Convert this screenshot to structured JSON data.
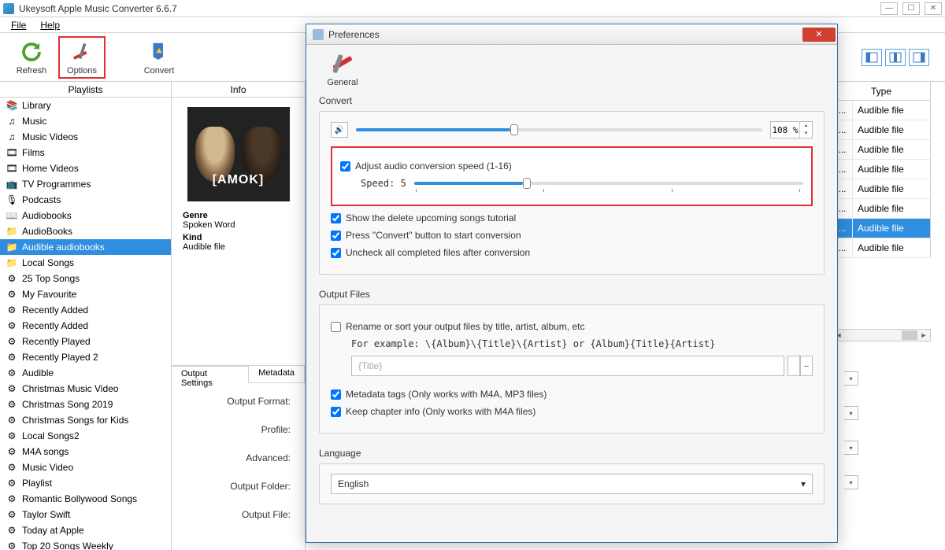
{
  "window": {
    "title": "Ukeysoft Apple Music Converter 6.6.7"
  },
  "menu": {
    "file": "File",
    "help": "Help"
  },
  "toolbar": {
    "refresh": "Refresh",
    "options": "Options",
    "convert": "Convert"
  },
  "sidebar": {
    "header": "Playlists",
    "items": [
      {
        "label": "Library",
        "icon": "library"
      },
      {
        "label": "Music",
        "icon": "music"
      },
      {
        "label": "Music Videos",
        "icon": "music"
      },
      {
        "label": "Films",
        "icon": "film"
      },
      {
        "label": "Home Videos",
        "icon": "film"
      },
      {
        "label": "TV Programmes",
        "icon": "tv"
      },
      {
        "label": "Podcasts",
        "icon": "podcast"
      },
      {
        "label": "Audiobooks",
        "icon": "book"
      },
      {
        "label": "AudioBooks",
        "icon": "folder"
      },
      {
        "label": "Audible audiobooks",
        "icon": "folder",
        "selected": true
      },
      {
        "label": "Local Songs",
        "icon": "folder"
      },
      {
        "label": "25 Top Songs",
        "icon": "gear"
      },
      {
        "label": "My Favourite",
        "icon": "gear"
      },
      {
        "label": "Recently Added",
        "icon": "gear"
      },
      {
        "label": "Recently Added",
        "icon": "gear"
      },
      {
        "label": "Recently Played",
        "icon": "gear"
      },
      {
        "label": "Recently Played 2",
        "icon": "gear"
      },
      {
        "label": "Audible",
        "icon": "gear"
      },
      {
        "label": "Christmas Music Video",
        "icon": "gear"
      },
      {
        "label": "Christmas Song 2019",
        "icon": "gear"
      },
      {
        "label": "Christmas Songs for Kids",
        "icon": "gear"
      },
      {
        "label": "Local Songs2",
        "icon": "gear"
      },
      {
        "label": "M4A songs",
        "icon": "gear"
      },
      {
        "label": "Music Video",
        "icon": "gear"
      },
      {
        "label": "Playlist",
        "icon": "gear"
      },
      {
        "label": "Romantic Bollywood Songs",
        "icon": "gear"
      },
      {
        "label": "Taylor Swift",
        "icon": "gear"
      },
      {
        "label": "Today at Apple",
        "icon": "gear"
      },
      {
        "label": "Top 20 Songs Weekly",
        "icon": "gear"
      }
    ]
  },
  "info": {
    "header": "Info",
    "genre_label": "Genre",
    "genre_value": "Spoken Word",
    "kind_label": "Kind",
    "kind_value": "Audible file"
  },
  "type_column": {
    "header": "Type",
    "rows": [
      {
        "v": "Audible file"
      },
      {
        "v": "Audible file"
      },
      {
        "v": "Audible file"
      },
      {
        "v": "Audible file"
      },
      {
        "v": "Audible file"
      },
      {
        "v": "Audible file"
      },
      {
        "v": "Audible file",
        "selected": true
      },
      {
        "v": "Audible file"
      }
    ],
    "dots": "..."
  },
  "settings": {
    "tab1": "Output Settings",
    "tab2": "Metadata",
    "output_format": "Output Format:",
    "profile": "Profile:",
    "advanced": "Advanced:",
    "output_folder": "Output Folder:",
    "output_file": "Output File:"
  },
  "prefs": {
    "title": "Preferences",
    "general": "General",
    "convert_section": "Convert",
    "volume_pct": "108 %",
    "adjust_speed": "Adjust audio conversion speed (1-16)",
    "speed_label": "Speed: 5",
    "show_delete": "Show the delete upcoming songs tutorial",
    "press_convert": "Press \"Convert\" button to start conversion",
    "uncheck_completed": "Uncheck all completed files after conversion",
    "output_files_section": "Output Files",
    "rename_label": "Rename or sort your output files by title, artist, album, etc",
    "rename_example": "For example: \\{Album}\\{Title}\\{Artist} or {Album}{Title}{Artist}",
    "rename_placeholder": "{Title}",
    "metadata_tags": "Metadata tags (Only works with M4A, MP3 files)",
    "keep_chapter": "Keep chapter info (Only works with M4A files)",
    "language_section": "Language",
    "language_value": "English"
  }
}
